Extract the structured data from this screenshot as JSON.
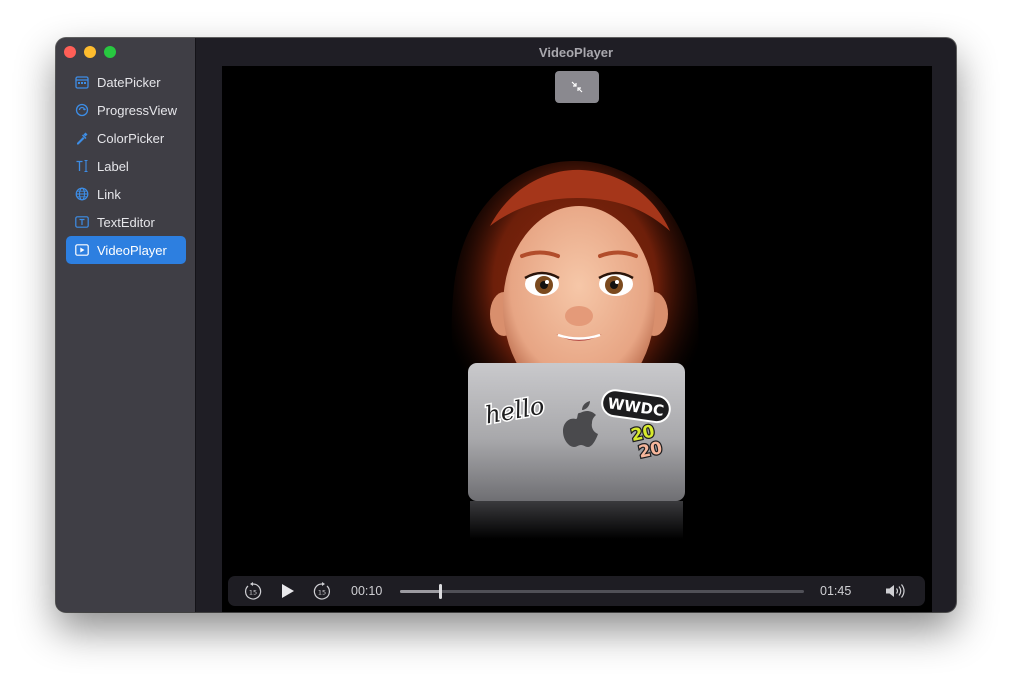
{
  "window": {
    "title": "VideoPlayer"
  },
  "colors": {
    "close": "#ff5f57",
    "minimize": "#febc2e",
    "zoom": "#28c840",
    "selection": "#2d7fe0",
    "accent_icon": "#3d8de6"
  },
  "sidebar": {
    "items": [
      {
        "label": "DatePicker",
        "icon": "calendar-icon",
        "selected": false
      },
      {
        "label": "ProgressView",
        "icon": "progress-circle-icon",
        "selected": false
      },
      {
        "label": "ColorPicker",
        "icon": "eyedropper-icon",
        "selected": false
      },
      {
        "label": "Label",
        "icon": "text-cursor-icon",
        "selected": false
      },
      {
        "label": "Link",
        "icon": "globe-icon",
        "selected": false
      },
      {
        "label": "TextEditor",
        "icon": "text-box-icon",
        "selected": false
      },
      {
        "label": "VideoPlayer",
        "icon": "play-rectangle-icon",
        "selected": true
      }
    ]
  },
  "video": {
    "fullscreen_icon": "exit-fullscreen-icon",
    "stickers": {
      "hello": "hello",
      "wwdc": "WWDC",
      "year_top": "20",
      "year_bottom": "20"
    }
  },
  "controls": {
    "skip_back_label": "15",
    "skip_forward_label": "15",
    "current_time": "00:10",
    "duration": "01:45",
    "progress": 0.1,
    "icons": [
      "skip-back-15-icon",
      "play-icon",
      "skip-forward-15-icon",
      "volume-icon"
    ]
  }
}
